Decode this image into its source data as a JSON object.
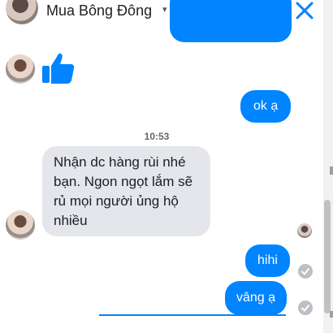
{
  "header": {
    "contact_name": "Mua Bông Đông",
    "chevron": "▾",
    "video_icon": "video-camera-icon",
    "phone_icon": "phone-icon",
    "close_icon": "close-icon"
  },
  "messages": {
    "thumbs_up": "thumbs-up-icon",
    "ok": "ok ạ",
    "timestamp": "10:53",
    "incoming_text": "Nhận dc hàng rùi nhé bạn. Ngon ngọt lắm sẽ rủ mọi người ủng hộ nhiều",
    "hihi": "hihi",
    "vang": "vâng ạ"
  },
  "colors": {
    "outgoing_bubble": "#0084ff",
    "incoming_bubble": "#e4e6eb",
    "accent": "#0084ff"
  }
}
